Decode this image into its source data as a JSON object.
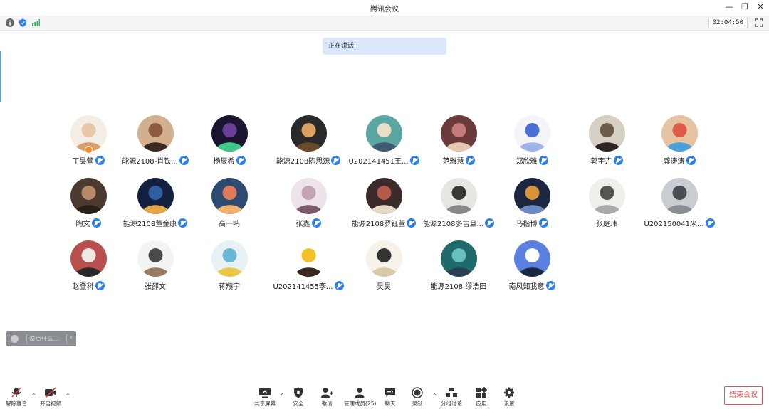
{
  "window": {
    "title": "腾讯会议",
    "minimize_icon": "minimize-icon",
    "restore_icon": "restore-icon",
    "close_icon": "close-icon"
  },
  "topbar": {
    "timer": "02:04:50",
    "icons": [
      "info-icon",
      "shield-icon",
      "signal-icon",
      "fullscreen-icon"
    ]
  },
  "speaking_label": "正在讲话:",
  "participants": [
    {
      "name": "丁昊萱",
      "mic": true,
      "host": true
    },
    {
      "name": "能源2108-肖铁...",
      "mic": true
    },
    {
      "name": "杨辰希",
      "mic": true
    },
    {
      "name": "能源2108陈思源",
      "mic": true
    },
    {
      "name": "U202141451王...",
      "mic": true
    },
    {
      "name": "范雅慧",
      "mic": true
    },
    {
      "name": "郑欣雅",
      "mic": true
    },
    {
      "name": "郭宇卉",
      "mic": true
    },
    {
      "name": "龚涛涛",
      "mic": true
    },
    {
      "name": "陶文",
      "mic": true
    },
    {
      "name": "能源2108董金康",
      "mic": true
    },
    {
      "name": "高一鸣",
      "mic": false
    },
    {
      "name": "张鑫",
      "mic": true
    },
    {
      "name": "能源2108罗钰萱",
      "mic": true
    },
    {
      "name": "能源2108多吉旦...",
      "mic": true
    },
    {
      "name": "马楷博",
      "mic": true
    },
    {
      "name": "张庭玮",
      "mic": false
    },
    {
      "name": "U202150041米...",
      "mic": true
    },
    {
      "name": "赵登科",
      "mic": true
    },
    {
      "name": "张邵文",
      "mic": false
    },
    {
      "name": "蒋翔宇",
      "mic": false
    },
    {
      "name": "U202141455李...",
      "mic": true
    },
    {
      "name": "吴昊",
      "mic": false
    },
    {
      "name": "能源2108 缪浩田",
      "mic": false
    },
    {
      "name": "南风知我意",
      "mic": true
    }
  ],
  "chat_input": {
    "placeholder": "说点什么..."
  },
  "toolbar": {
    "unmute": "解除静音",
    "video": "开启视频",
    "share": "共享屏幕",
    "security": "安全",
    "invite": "邀请",
    "members": "管理成员(25)",
    "chat": "聊天",
    "record": "录制",
    "breakout": "分组讨论",
    "apps": "应用",
    "settings": "设置",
    "end": "结束会议"
  },
  "colors": {
    "accent": "#2b7ff0",
    "end": "#e05252",
    "speaking_bg": "#dbe8fb"
  }
}
